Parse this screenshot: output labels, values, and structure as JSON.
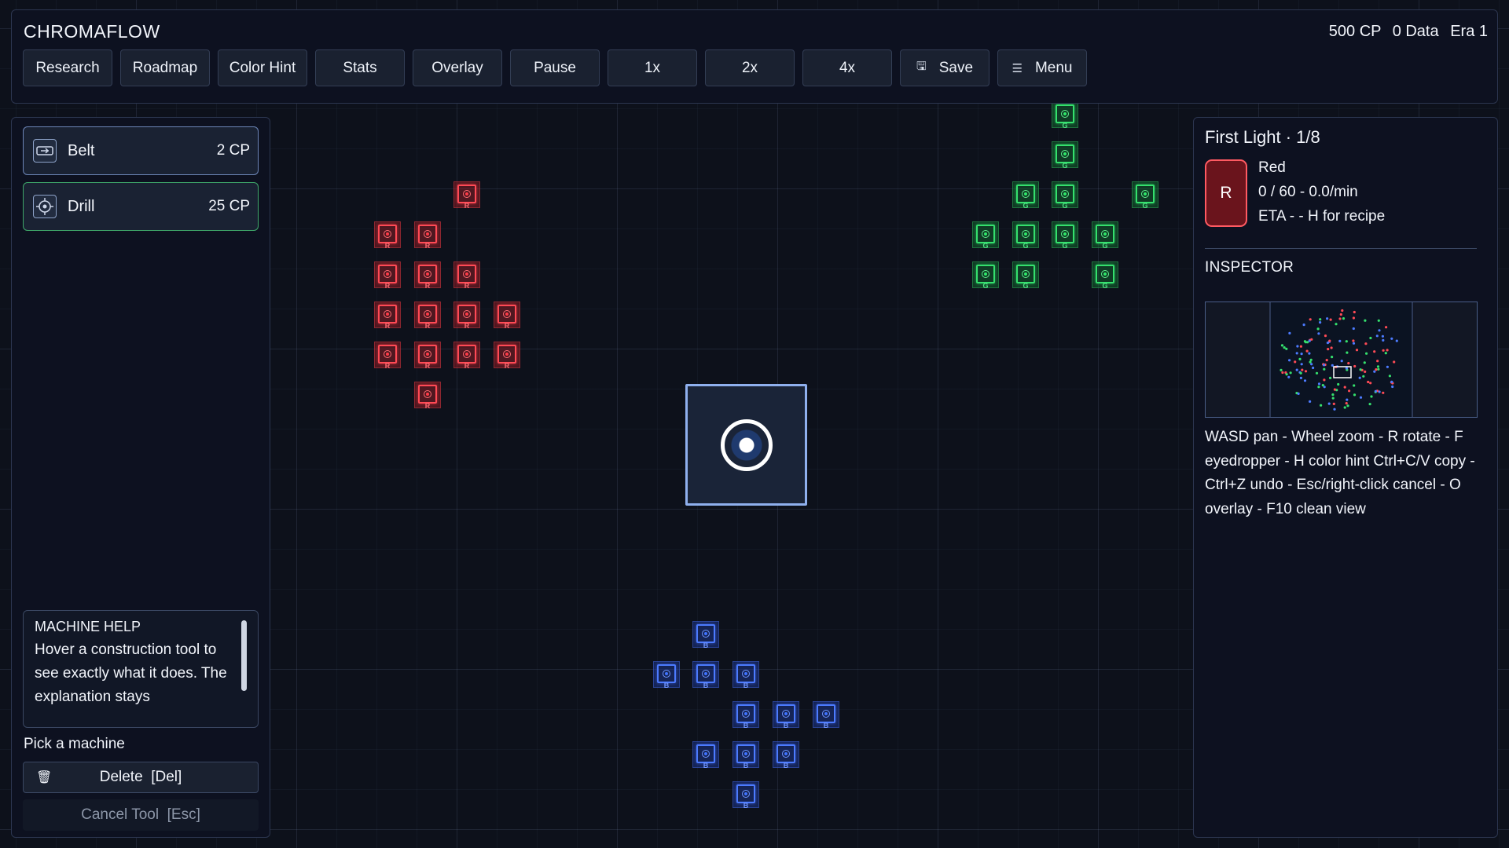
{
  "header": {
    "title": "CHROMAFLOW",
    "resources": {
      "cp": "500 CP",
      "data": "0 Data",
      "era": "Era 1"
    },
    "buttons": [
      {
        "label": "Research"
      },
      {
        "label": "Roadmap"
      },
      {
        "label": "Color Hint"
      },
      {
        "label": "Stats"
      },
      {
        "label": "Overlay"
      },
      {
        "label": "Pause"
      },
      {
        "label": "1x"
      },
      {
        "label": "2x"
      },
      {
        "label": "4x"
      },
      {
        "label": "Save",
        "icon": "save-icon"
      },
      {
        "label": "Menu",
        "icon": "menu-icon"
      }
    ]
  },
  "tools": [
    {
      "name": "Belt",
      "cost": "2 CP",
      "icon": "belt-icon"
    },
    {
      "name": "Drill",
      "cost": "25 CP",
      "icon": "drill-icon"
    }
  ],
  "machine_help": {
    "title": "MACHINE HELP",
    "body": "Hover a construction tool to see exactly what it does. The explanation stays"
  },
  "pick_label": "Pick a machine",
  "delete_label": "Delete  [Del]",
  "cancel_label": "Cancel Tool  [Esc]",
  "goal": {
    "title": "First Light · 1/8",
    "swatch_letter": "R",
    "color_name": "Red",
    "progress": "0 / 60  -  0.0/min",
    "eta": "ETA -  -  H for recipe",
    "swatch_color": "#ff5a62"
  },
  "inspector": {
    "label": "INSPECTOR"
  },
  "help_text": "WASD pan - Wheel zoom - R rotate - F eyedropper - H color hint Ctrl+C/V copy - Ctrl+Z undo - Esc/right-click cancel - O overlay - F10 clean view",
  "colors": {
    "red": "#ff4a55",
    "green": "#35e06d",
    "blue": "#4c7bff",
    "accent": "#8fb0ee"
  },
  "deposits": {
    "red_label": "R",
    "green_label": "G",
    "blue_label": "B"
  }
}
